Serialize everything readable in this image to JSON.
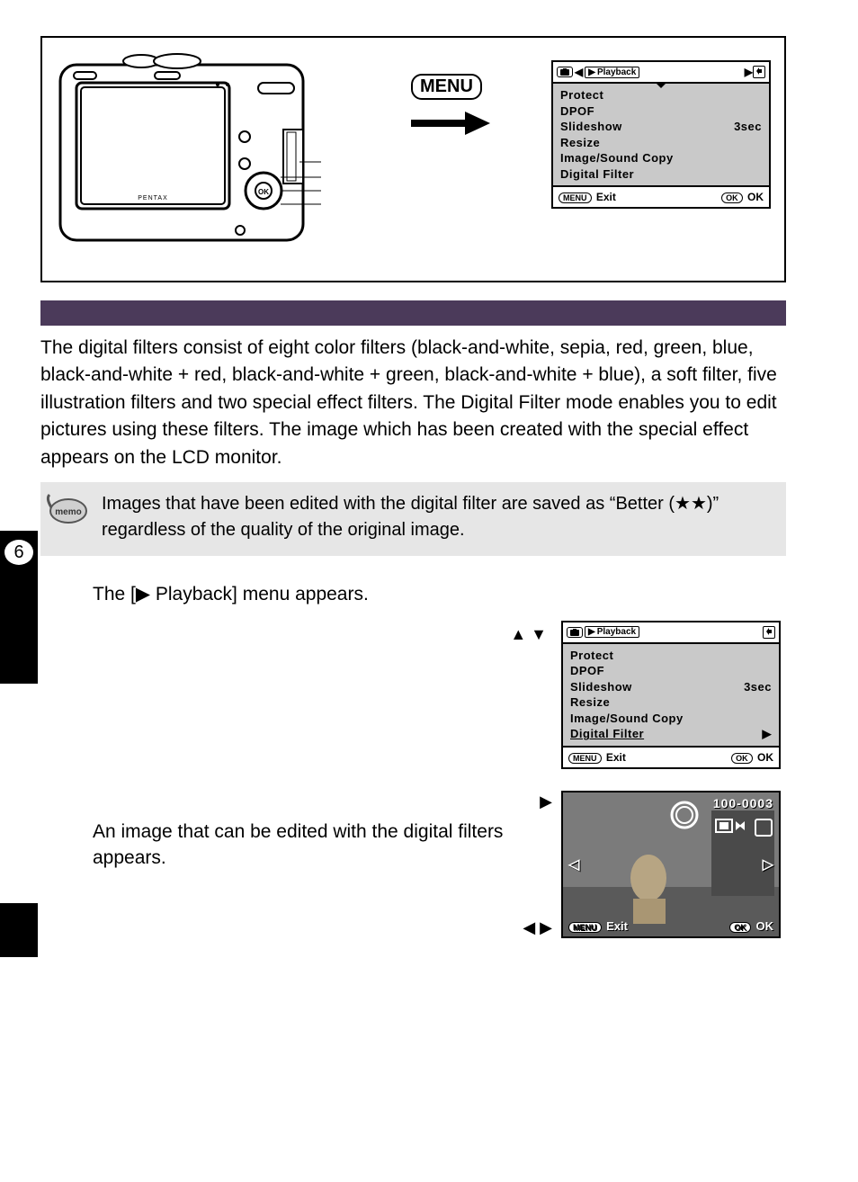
{
  "side": {
    "chapter": "6"
  },
  "top_menu_button": "MENU",
  "menu1": {
    "tab_label": "Playback",
    "items": {
      "protect": "Protect",
      "dpof": "DPOF",
      "slideshow": "Slideshow",
      "slideshow_val": "3sec",
      "resize": "Resize",
      "imgcopy": "Image/Sound Copy",
      "digfilter": "Digital Filter"
    },
    "foot_exit": "Exit",
    "foot_ok": "OK",
    "menu_pill": "MENU",
    "ok_pill": "OK"
  },
  "body_para": "The digital filters consist of eight color filters (black-and-white, sepia, red, green, blue, black-and-white + red, black-and-white + green, black-and-white + blue), a soft filter, five illustration filters and two special effect filters. The Digital Filter mode enables you to edit pictures using these filters. The image which has been created with the special effect appears on the LCD monitor.",
  "memo_label": "memo",
  "memo_text": "Images that have been edited with the digital filter are saved as “Better (★★)” regardless of the quality of the original image.",
  "step1_text": "The [▶ Playback] menu appears.",
  "arrows_ud": "▲ ▼",
  "arrow_r": "▶",
  "arrows_lr": "◀ ▶",
  "menu2": {
    "tab_label": "Playback",
    "items": {
      "protect": "Protect",
      "dpof": "DPOF",
      "slideshow": "Slideshow",
      "slideshow_val": "3sec",
      "resize": "Resize",
      "imgcopy": "Image/Sound Copy",
      "digfilter": "Digital Filter"
    },
    "foot_exit": "Exit",
    "foot_ok": "OK",
    "menu_pill": "MENU",
    "ok_pill": "OK"
  },
  "step3_text": "An image that can be edited with the digital filters appears.",
  "photo": {
    "counter": "100-0003",
    "menu_pill": "MENU",
    "exit": "Exit",
    "ok_pill": "OK",
    "ok": "OK"
  }
}
